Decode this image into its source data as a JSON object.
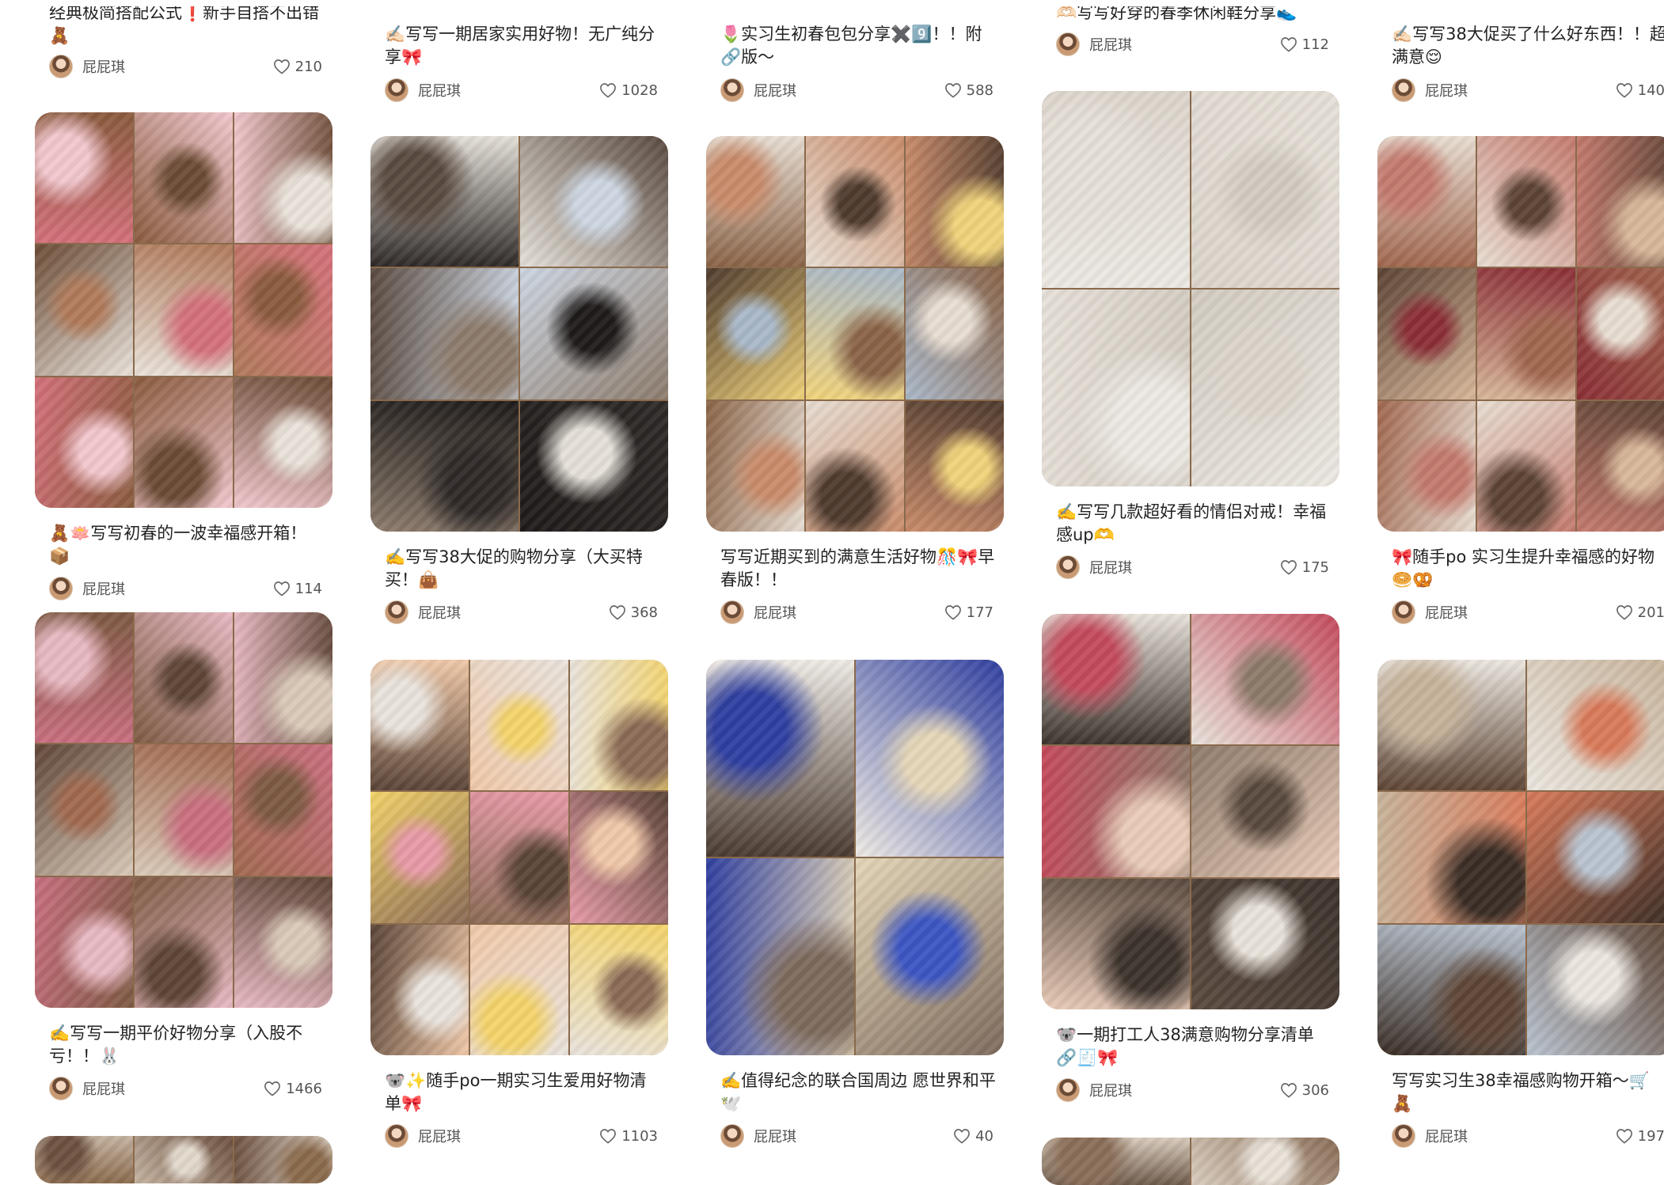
{
  "feed": {
    "author": "屁屁琪",
    "columns": [
      {
        "cards": [
          {
            "title": "经典极简搭配公式❗新手自搭不出错🧸",
            "likes": "210",
            "palette": [
              "#7b5a3f",
              "#c9b9a4",
              "#5c4433",
              "#e7e0d6",
              "#a58060",
              "#3e2f26"
            ]
          },
          {
            "title": "🧸🪷写写初春的一波幸福感开箱！📦",
            "likes": "114",
            "palette": [
              "#d4707a",
              "#8a5b3e",
              "#f1c7cd",
              "#6b4b35",
              "#e9e2da",
              "#b07a5a"
            ]
          },
          {
            "title": "✍️写写一期平价好物分享（入股不亏！！🐰",
            "likes": "1466",
            "palette": [
              "#c96e7f",
              "#7d5a43",
              "#e8b9c2",
              "#5e4536",
              "#d9c9b8",
              "#a1694f"
            ]
          },
          {
            "title": "",
            "likes": "",
            "palette": [
              "#8a6a4c",
              "#c4b2a0",
              "#6d5140",
              "#e2d8cc"
            ]
          }
        ]
      },
      {
        "cards": [
          {
            "title": "✍🏻写写一期居家实用好物！无广纯分享🎀",
            "likes": "1028",
            "palette": [
              "#6b5444",
              "#d9d2c8",
              "#4e3d32",
              "#b89f86"
            ]
          },
          {
            "title": "✍️写写38大促的购物分享（大买特买！👜",
            "likes": "368",
            "palette": [
              "#2f2a28",
              "#e4e0d8",
              "#5a4a40",
              "#cdd6e2",
              "#8c7b6c",
              "#1e1b1a"
            ]
          },
          {
            "title": "🐨✨随手po一期实习生爱用好物清单🎀",
            "likes": "1103",
            "palette": [
              "#5a4437",
              "#f0c8a8",
              "#e9e3dc",
              "#f3d36a",
              "#8a6a55",
              "#e79aa7"
            ]
          }
        ]
      },
      {
        "cards": [
          {
            "title": "🌷实习生初春包包分享✖️9️⃣！！附🔗版～",
            "likes": "588",
            "palette": [
              "#6e5443",
              "#e2d9cf",
              "#8e6b52",
              "#c7a689"
            ]
          },
          {
            "title": "写写近期买到的满意生活好物🎊🎀早春版！！",
            "likes": "177",
            "palette": [
              "#8a6347",
              "#e7ddd2",
              "#c98b6a",
              "#4f3b2e",
              "#f0d27a",
              "#a9b8c8"
            ]
          },
          {
            "title": "✍️值得纪念的联合国周边 愿世界和平🕊️",
            "likes": "40",
            "palette": [
              "#4a3a30",
              "#eeeae4",
              "#2f3fa0",
              "#e4d6b8",
              "#7d6a5c",
              "#3b55c4"
            ]
          }
        ]
      },
      {
        "cards": [
          {
            "title": "🫶🏻写写好穿的春季休闲鞋分享👟",
            "likes": "112",
            "palette": [
              "#d9d3cb",
              "#8c7b6c",
              "#f1ece6",
              "#5e4f44"
            ]
          },
          {
            "title": "✍️写写几款超好看的情侣对戒！幸福感up🫶",
            "likes": "175",
            "palette": [
              "#ece8e2",
              "#dcd5cc",
              "#e6e0d8",
              "#d2cbc1"
            ]
          },
          {
            "title": "🐨一期打工人38满意购物分享清单🔗🧾🎀",
            "likes": "306",
            "palette": [
              "#3d332d",
              "#e8e2da",
              "#c44a5c",
              "#8d7a6a",
              "#e9cbb8",
              "#5a4a3f"
            ]
          },
          {
            "title": "",
            "likes": "",
            "palette": [
              "#6e5a4a",
              "#d8cbbc",
              "#8a6e58",
              "#e9e2d9"
            ]
          }
        ]
      },
      {
        "cards": [
          {
            "title": "✍🏻写写38大促买了什么好东西！！超满意😌",
            "likes": "140",
            "palette": [
              "#7a5a44",
              "#e6ddd2",
              "#b58a6a",
              "#4f3b2f"
            ]
          },
          {
            "title": "🎀随手po 实习生提升幸福感的好物🥯🥨",
            "likes": "201",
            "palette": [
              "#a0664e",
              "#e8ddd1",
              "#c47a6e",
              "#5c4334",
              "#d8b79a",
              "#8b2f36"
            ]
          },
          {
            "title": "写写实习生38幸福感购物开箱～🛒🧸",
            "likes": "197",
            "palette": [
              "#5e4535",
              "#ebe6df",
              "#c7b39a",
              "#d97a5a",
              "#3a2d25",
              "#b9c3cf"
            ]
          }
        ]
      }
    ]
  }
}
